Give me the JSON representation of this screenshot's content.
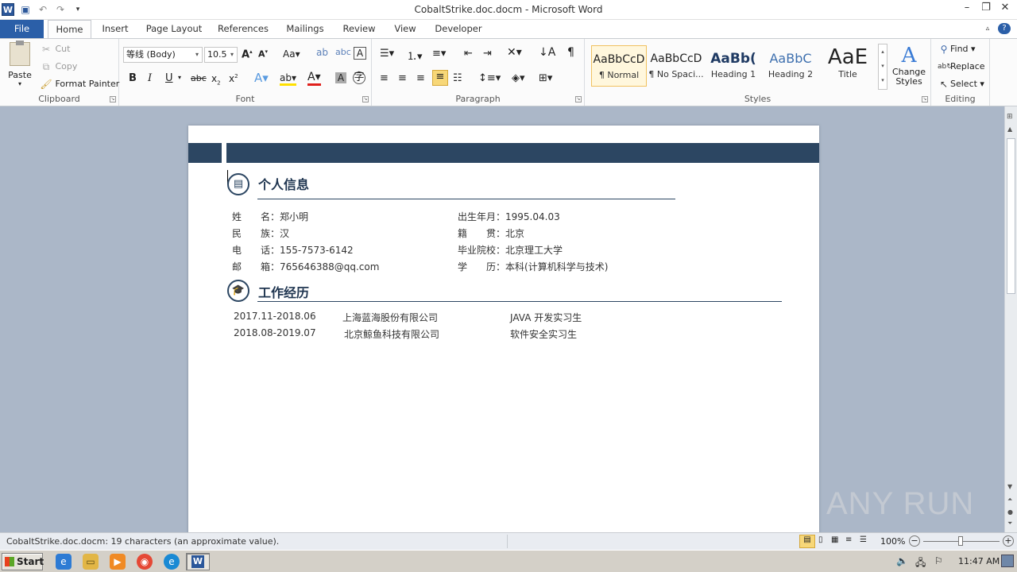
{
  "window": {
    "title": "CobaltStrike.doc.docm - Microsoft Word"
  },
  "titlebar_icons": {
    "app": "word-icon",
    "save": "save-icon",
    "undo": "undo-icon",
    "redo": "redo-icon",
    "customize": "customize-qat-icon"
  },
  "tabs": [
    {
      "label": "File"
    },
    {
      "label": "Home"
    },
    {
      "label": "Insert"
    },
    {
      "label": "Page Layout"
    },
    {
      "label": "References"
    },
    {
      "label": "Mailings"
    },
    {
      "label": "Review"
    },
    {
      "label": "View"
    },
    {
      "label": "Developer"
    }
  ],
  "ribbon": {
    "clipboard": {
      "group_label": "Clipboard",
      "paste": "Paste",
      "cut": "Cut",
      "copy": "Copy",
      "format_painter": "Format Painter"
    },
    "font": {
      "group_label": "Font",
      "font_name": "等线 (Body)",
      "font_size": "10.5"
    },
    "paragraph": {
      "group_label": "Paragraph"
    },
    "styles": {
      "group_label": "Styles",
      "items": [
        {
          "sample": "AaBbCcD",
          "name": "¶ Normal"
        },
        {
          "sample": "AaBbCcD",
          "name": "¶ No Spaci..."
        },
        {
          "sample": "AaBb(",
          "name": "Heading 1"
        },
        {
          "sample": "AaBbC",
          "name": "Heading 2"
        },
        {
          "sample": "AaE",
          "name": "Title"
        }
      ],
      "change_styles": "Change Styles"
    },
    "editing": {
      "group_label": "Editing",
      "find": "Find",
      "replace": "Replace",
      "select": "Select"
    }
  },
  "document": {
    "personal": {
      "title": "个人信息",
      "left": [
        {
          "label": "姓　　名：",
          "value": "郑小明"
        },
        {
          "label": "民　　族：",
          "value": "汉"
        },
        {
          "label": "电　　话：",
          "value": "155-7573-6142"
        },
        {
          "label": "邮　　箱：",
          "value": "765646388@qq.com"
        }
      ],
      "right": [
        {
          "label": "出生年月：",
          "value": "1995.04.03"
        },
        {
          "label": "籍　　贯：",
          "value": "北京"
        },
        {
          "label": "毕业院校：",
          "value": "北京理工大学"
        },
        {
          "label": "学　　历：",
          "value": "本科(计算机科学与技术)"
        }
      ]
    },
    "work": {
      "title": "工作经历",
      "rows": [
        {
          "period": "2017.11-2018.06",
          "company": "上海蓝海股份有限公司",
          "position": "JAVA 开发实习生"
        },
        {
          "period": "2018.08-2019.07",
          "company": "北京鲸鱼科技有限公司",
          "position": "软件安全实习生"
        }
      ]
    }
  },
  "statusbar": {
    "text": "CobaltStrike.doc.docm: 19 characters (an approximate value).",
    "zoom": "100%"
  },
  "taskbar": {
    "start": "Start",
    "time": "11:47 AM"
  },
  "watermark": "ANY RUN"
}
